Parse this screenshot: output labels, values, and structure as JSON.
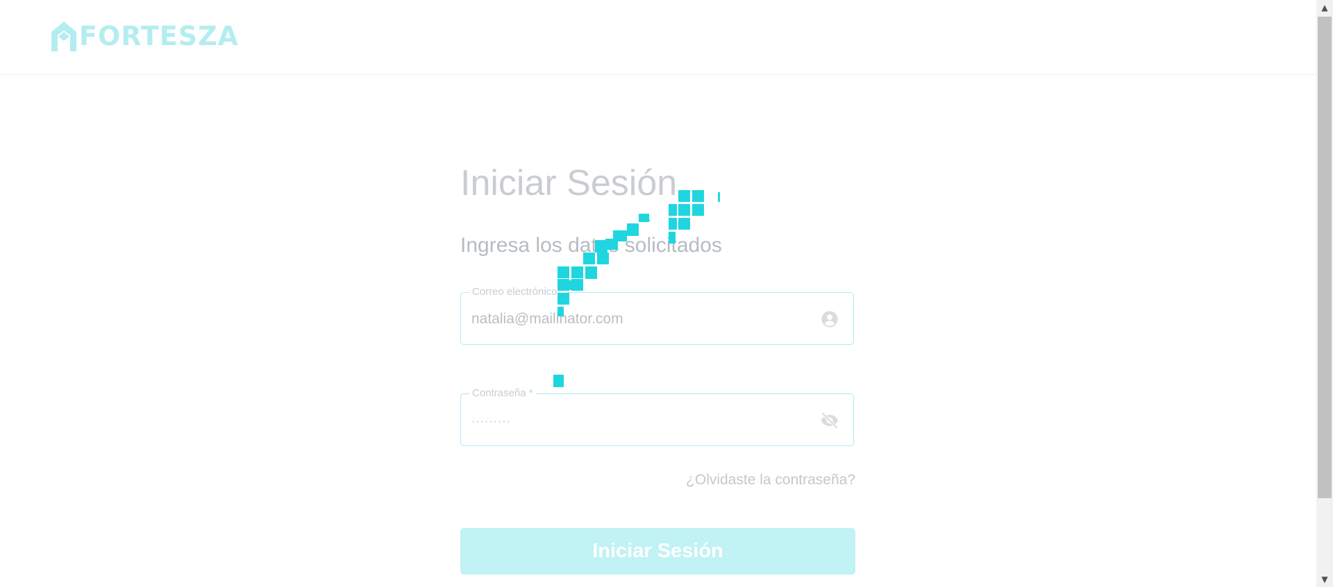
{
  "header": {
    "brand_name": "FORTESZA",
    "logo_icon": "house-icon"
  },
  "login": {
    "title": "Iniciar Sesión",
    "subtitle": "Ingresa los datos solicitados",
    "email": {
      "label": "Correo electrónico *",
      "value": "natalia@mailinator.com",
      "icon": "account-circle-icon"
    },
    "password": {
      "label": "Contraseña *",
      "value": "·········",
      "icon": "eye-off-icon"
    },
    "forgot_link": "¿Olvidaste la contraseña?",
    "submit_label": "Iniciar Sesión"
  },
  "overlay": {
    "loader": "loading-spinner",
    "color": "#1fd6e0"
  },
  "colors": {
    "brand": "#b4edf0",
    "button_bg": "#c1f2f4",
    "field_border": "#aeeaf0"
  }
}
